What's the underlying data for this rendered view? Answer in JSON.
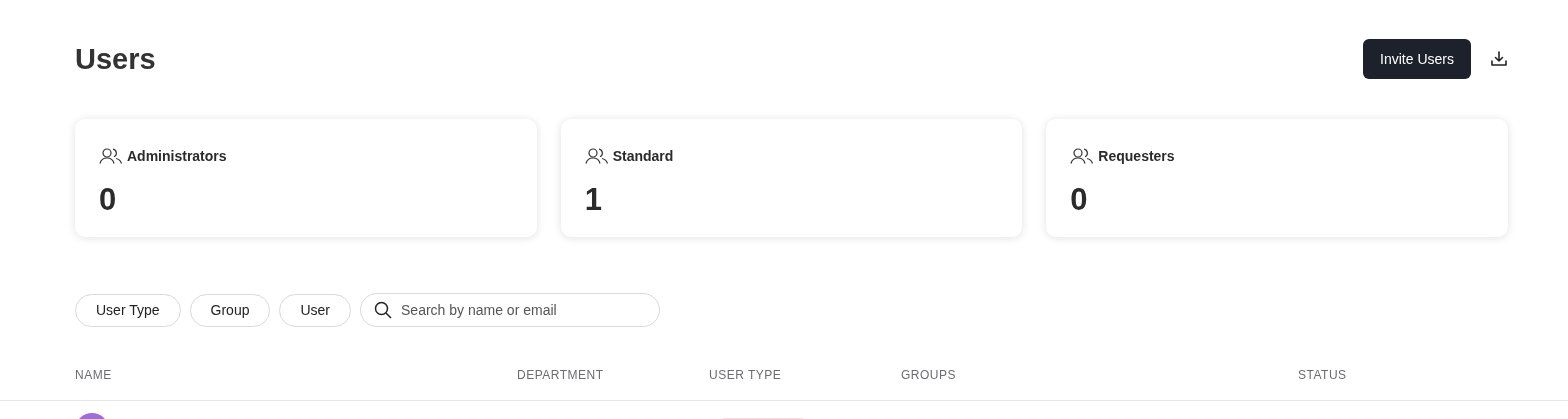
{
  "page": {
    "title": "Users",
    "invite_button": "Invite Users"
  },
  "stats": [
    {
      "label": "Administrators",
      "value": "0"
    },
    {
      "label": "Standard",
      "value": "1"
    },
    {
      "label": "Requesters",
      "value": "0"
    }
  ],
  "filters": [
    "User Type",
    "Group",
    "User"
  ],
  "search": {
    "placeholder": "Search by name or email"
  },
  "table": {
    "columns": [
      "NAME",
      "DEPARTMENT",
      "USER TYPE",
      "GROUPS",
      "STATUS"
    ]
  }
}
